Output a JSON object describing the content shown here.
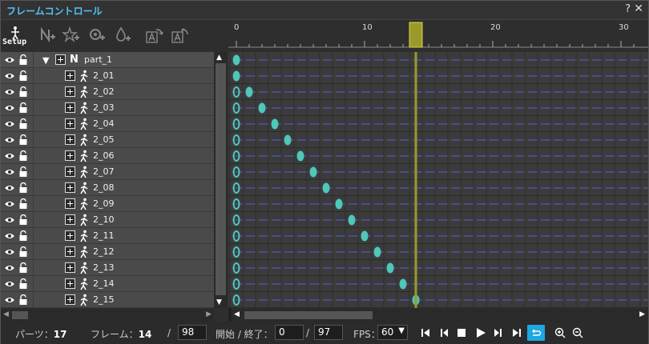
{
  "window": {
    "title": "フレームコントロール",
    "help": "?",
    "close": "✕"
  },
  "toolbar": {
    "setup_label": "Setup",
    "buttons": [
      "setup-icon",
      "add-null-icon",
      "add-star-icon",
      "add-gear-icon",
      "add-drop-icon",
      "text-rotate-left-icon",
      "text-rotate-right-icon"
    ]
  },
  "layers": {
    "parent": {
      "name": "part_1"
    },
    "children": [
      {
        "name": "2_01"
      },
      {
        "name": "2_02"
      },
      {
        "name": "2_03"
      },
      {
        "name": "2_04"
      },
      {
        "name": "2_05"
      },
      {
        "name": "2_06"
      },
      {
        "name": "2_07"
      },
      {
        "name": "2_08"
      },
      {
        "name": "2_09"
      },
      {
        "name": "2_10"
      },
      {
        "name": "2_11"
      },
      {
        "name": "2_12"
      },
      {
        "name": "2_13"
      },
      {
        "name": "2_14"
      },
      {
        "name": "2_15"
      }
    ]
  },
  "timeline": {
    "ruler_labels": [
      "0",
      "10",
      "20",
      "30"
    ],
    "current_frame": 14,
    "visible_frames": 31,
    "keyframes": [
      0,
      0,
      1,
      2,
      3,
      4,
      5,
      6,
      7,
      8,
      9,
      10,
      11,
      12,
      13,
      14
    ],
    "colors": {
      "keyframe": "#4fc7b9",
      "playhead": "#9a9a2a",
      "row_line": "#4c4c8c"
    }
  },
  "status": {
    "parts_label": "パーツ：",
    "parts_value": "17",
    "frame_label": "フレーム：",
    "frame_value": "14",
    "frame_sep": "/",
    "frame_total": "98",
    "range_label": "開始 / 終了：",
    "range_start": "0",
    "range_sep": "/",
    "range_end": "97",
    "fps_label": "FPS：",
    "fps_value": "60"
  }
}
